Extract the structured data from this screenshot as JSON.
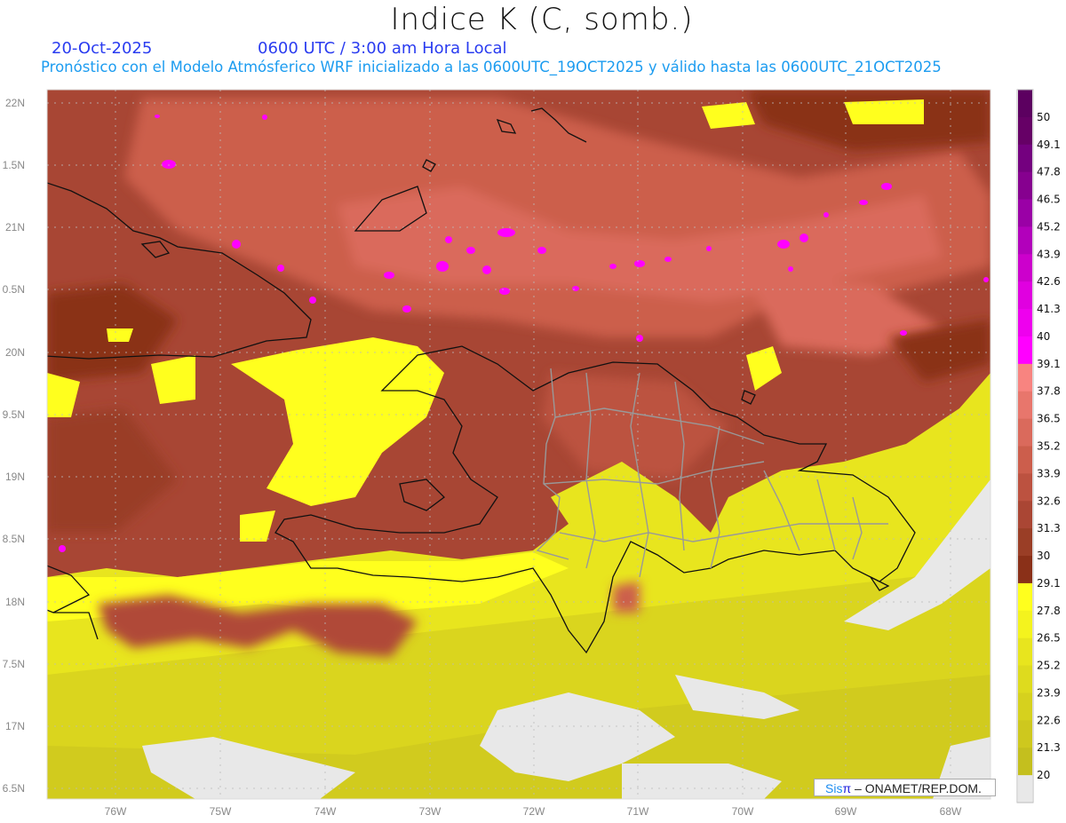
{
  "header": {
    "title": "Indice K (C, somb.)",
    "date": "20-Oct-2025",
    "time": "0600 UTC / 3:00 am Hora Local",
    "subtitle": "Pronóstico con el Modelo Atmósferico WRF inicializado a las 0600UTC_19OCT2025 y válido hasta las  0600UTC_21OCT2025"
  },
  "axes": {
    "lon_labels": [
      "76W",
      "75W",
      "74W",
      "73W",
      "72W",
      "71W",
      "70W",
      "69W",
      "68W"
    ],
    "lat_labels": [
      "22N",
      "1.5N",
      "21N",
      "0.5N",
      "20N",
      "9.5N",
      "19N",
      "8.5N",
      "18N",
      "7.5N",
      "17N",
      "6.5N"
    ]
  },
  "colorbar": {
    "labels": [
      "50",
      "49.1",
      "47.8",
      "46.5",
      "45.2",
      "43.9",
      "42.6",
      "41.3",
      "40",
      "39.1",
      "37.8",
      "36.5",
      "35.2",
      "33.9",
      "32.6",
      "31.3",
      "30",
      "29.1",
      "27.8",
      "26.5",
      "25.2",
      "23.9",
      "22.6",
      "21.3",
      "20"
    ],
    "colors": [
      "#660066",
      "#74007f",
      "#86008f",
      "#9a00a6",
      "#b200bb",
      "#cc00cc",
      "#e000e0",
      "#ee00ee",
      "#ff00ff",
      "#f88480",
      "#e8766c",
      "#da6a5c",
      "#cc5e4c",
      "#bc5240",
      "#aa4634",
      "#9a3e26",
      "#8a3018",
      "#ffff1e",
      "#f4f31e",
      "#e8e51e",
      "#dedb1e",
      "#d6d11e",
      "#cec81e",
      "#c4bf1e",
      "#e8e8e8"
    ]
  },
  "credit": {
    "sis": "Sis",
    "pi": "π",
    "rest": " – ONAMET/REP.DOM."
  }
}
